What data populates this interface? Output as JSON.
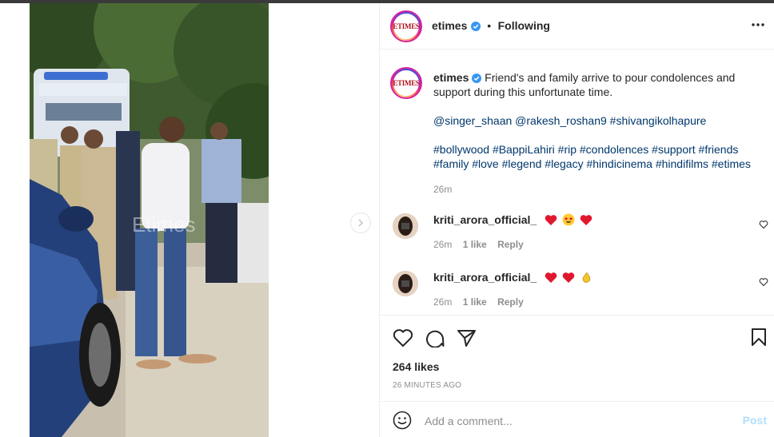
{
  "media": {
    "watermark": "Etimes"
  },
  "header": {
    "avatar_logo": "ETIMES",
    "username": "etimes",
    "separator": "•",
    "follow_state": "Following"
  },
  "caption": {
    "avatar_logo": "ETIMES",
    "username": "etimes",
    "text": "Friend's and family arrive to pour condolences and support during this unfortunate time.",
    "mentions": "@singer_shaan @rakesh_roshan9 #shivangikolhapure",
    "hashtags": "#bollywood #BappiLahiri #rip #condolences #support #friends #family #love #legend #legacy #hindicinema #hindifilms #etimes",
    "time": "26m"
  },
  "comments": [
    {
      "username": "kriti_arora_official_",
      "emojis": [
        "red-heart",
        "star-struck",
        "red-heart"
      ],
      "time": "26m",
      "likes": "1 like",
      "reply_label": "Reply"
    },
    {
      "username": "kriti_arora_official_",
      "emojis": [
        "red-heart",
        "red-heart",
        "clapping-hands"
      ],
      "time": "26m",
      "likes": "1 like",
      "reply_label": "Reply"
    }
  ],
  "actions": {
    "likes_count": "264 likes",
    "posted_ago": "26 minutes ago",
    "icons": [
      "heart-icon",
      "comment-icon",
      "share-icon",
      "bookmark-icon"
    ]
  },
  "add_comment": {
    "placeholder": "Add a comment...",
    "post_label": "Post"
  },
  "colors": {
    "link": "#00376b",
    "muted": "#8e8e8e",
    "verified": "#3897f0",
    "post_disabled": "#b2dffc",
    "brand": "#b5121b"
  }
}
